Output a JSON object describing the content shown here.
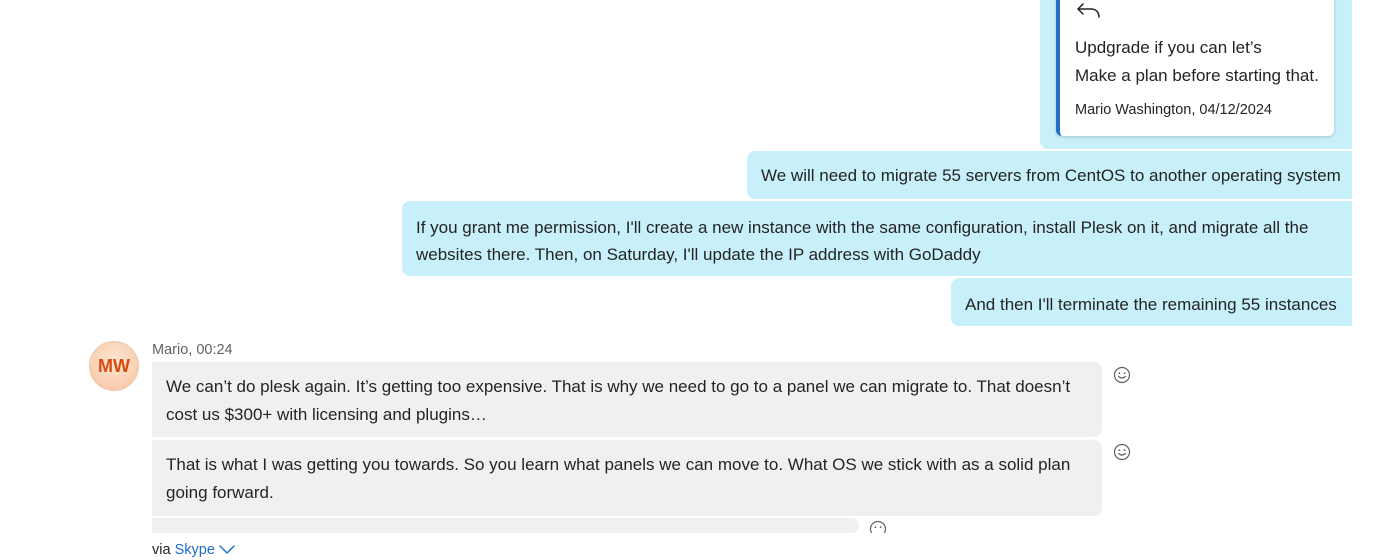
{
  "outgoing": {
    "quote": {
      "lines": [
        "Updgrade if you can let’s",
        "Make a plan before starting that."
      ],
      "author_date": "Mario Washington, 04/12/2024"
    },
    "messages": [
      "We will need to migrate 55 servers from CentOS to another operating system",
      "If you grant me permission, I'll create a new instance with the same configuration, install Plesk on it, and migrate all the websites there. Then, on Saturday, I'll update the IP address with GoDaddy",
      "And then I'll terminate the remaining 55 instances"
    ]
  },
  "incoming": {
    "avatar_initials": "MW",
    "sender_time": "Mario, 00:24",
    "messages": [
      "We can’t do plesk again. It’s getting too expensive. That is why we need to go to a panel we can migrate to. That doesn’t cost us $300+ with licensing and plugins…",
      "That is what I was getting you towards. So you learn what panels we can move to. What OS we stick with as a solid plan going forward."
    ]
  },
  "footer": {
    "via": "via",
    "source": "Skype"
  },
  "colors": {
    "outgoing_bubble": "#c7f0fb",
    "incoming_bubble": "#f0f0f0",
    "quote_accent": "#1f6fc8",
    "avatar_text": "#d74a0f",
    "link": "#1a6cc8"
  },
  "icons": {
    "reply": "reply-arrow-icon",
    "reaction": "emoji-smile-icon",
    "chevron": "chevron-down-icon"
  }
}
